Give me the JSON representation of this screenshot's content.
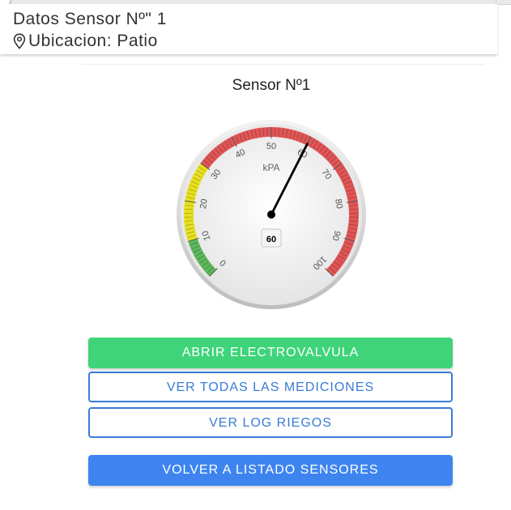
{
  "header": {
    "title": "Datos Sensor Nº\" 1",
    "location": "Ubicacion: Patio",
    "location_icon": "map-pin-icon"
  },
  "gauge": {
    "title": "Sensor Nº1",
    "units": "kPA",
    "value": 60,
    "value_label": "60",
    "min": 0,
    "max": 100,
    "major_ticks": [
      "0",
      "10",
      "20",
      "30",
      "40",
      "50",
      "60",
      "70",
      "80",
      "90",
      "100"
    ],
    "bands": [
      {
        "from": 0,
        "to": 10,
        "color": "#5cb85c"
      },
      {
        "from": 10,
        "to": 30,
        "color": "#e8e020"
      },
      {
        "from": 30,
        "to": 100,
        "color": "#e05555"
      }
    ]
  },
  "buttons": {
    "open_valve": "ABRIR ELECTROVALVULA",
    "all_measurements": "VER TODAS LAS MEDICIONES",
    "log": "VER LOG RIEGOS",
    "back": "VOLVER A LISTADO SENSORES"
  },
  "colors": {
    "green": "#3fd47a",
    "blue": "#3d84ef",
    "outline_blue": "#3a7bd5"
  }
}
